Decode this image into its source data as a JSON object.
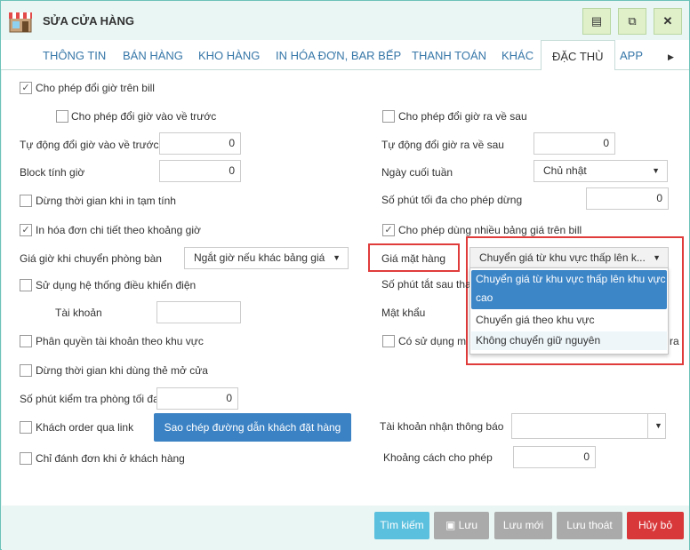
{
  "window": {
    "title": "SỬA CỬA HÀNG"
  },
  "tabs": [
    "THÔNG TIN",
    "BÁN HÀNG",
    "KHO HÀNG",
    "IN HÓA ĐƠN, BAR BẾP",
    "THANH TOÁN",
    "KHÁC",
    "ĐẶC THÙ",
    "APP"
  ],
  "form": {
    "allow_change_time": "Cho phép đổi giờ trên bill",
    "allow_change_in_before": "Cho phép đổi giờ vào về trước",
    "allow_change_out_after": "Cho phép đổi giờ ra về sau",
    "auto_change_in_before": "Tự động đổi giờ vào về trước",
    "auto_change_in_before_val": "0",
    "auto_change_out_after": "Tự động đổi giờ ra về sau",
    "auto_change_out_after_val": "0",
    "block_time": "Block tính giờ",
    "block_time_val": "0",
    "weekend": "Ngày cuối tuần",
    "weekend_val": "Chủ nhật",
    "stop_time_print": "Dừng thời gian khi in tạm tính",
    "max_stop_minutes": "Số phút tối đa cho phép dừng",
    "max_stop_minutes_val": "0",
    "print_detail_time": "In hóa đơn chi tiết theo khoảng giờ",
    "allow_multi_price": "Cho phép dùng nhiều bảng giá trên bill",
    "room_change_price": "Giá giờ khi chuyển phòng bàn",
    "room_change_price_val": "Ngắt giờ nếu khác bảng giá",
    "item_price": "Giá mặt hàng",
    "item_price_val": "Chuyển giá từ khu vực thấp lên k...",
    "use_electric": "Sử dụng hệ thống điều khiển điện",
    "auto_off_minutes": "Số phút tắt sau tha",
    "account": "Tài khoản",
    "password": "Mật khẩu",
    "area_permission": "Phân quyền tài khoản theo khu vực",
    "use_machine": "Có sử dụng m",
    "use_machine_suffix": "ra",
    "stop_time_card": "Dừng thời gian khi dùng thẻ mở cửa",
    "check_room_minutes": "Số phút kiểm tra phòng tối đa",
    "check_room_minutes_val": "0",
    "customer_order_link": "Khách order qua link",
    "copy_link_button": "Sao chép đường dẫn khách đặt hàng",
    "notify_account": "Tài khoản nhận thông báo",
    "only_customer_orders": "Chỉ đánh đơn khi ở khách hàng",
    "allowed_distance": "Khoảng cách cho phép",
    "allowed_distance_val": "0"
  },
  "dropdown": {
    "options": [
      "Chuyển giá từ khu vực thấp lên khu vực cao",
      "Chuyển giá theo khu vực",
      "Không chuyển giữ nguyên"
    ]
  },
  "footer": {
    "search": "Tìm kiếm",
    "save": "Lưu",
    "save_new": "Lưu mới",
    "save_exit": "Lưu thoát",
    "cancel": "Hủy bỏ"
  },
  "colors": {
    "accent": "#3b82c4",
    "cancel": "#d9383a",
    "search": "#5bc0de",
    "disabled": "#aaa",
    "highlight": "#e03c3c"
  }
}
